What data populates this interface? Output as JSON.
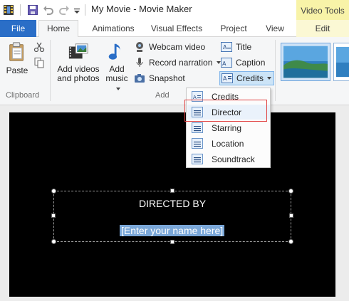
{
  "window": {
    "title": "My Movie - Movie Maker",
    "context_tab_header": "Video Tools"
  },
  "quick_access": {
    "icons": [
      "app-icon",
      "save-icon",
      "undo-icon",
      "redo-icon",
      "customize-arrow-icon"
    ]
  },
  "tabs": [
    {
      "label": "File",
      "active": false
    },
    {
      "label": "Home",
      "active": true
    },
    {
      "label": "Animations",
      "active": false
    },
    {
      "label": "Visual Effects",
      "active": false
    },
    {
      "label": "Project",
      "active": false
    },
    {
      "label": "View",
      "active": false
    },
    {
      "label": "Edit",
      "active": false,
      "context": true
    }
  ],
  "ribbon": {
    "clipboard": {
      "label": "Clipboard",
      "paste": "Paste"
    },
    "add": {
      "label": "Add",
      "add_videos_line1": "Add videos",
      "add_videos_line2": "and photos",
      "add_music_line1": "Add",
      "add_music_line2": "music",
      "webcam": "Webcam video",
      "narration": "Record narration",
      "snapshot": "Snapshot",
      "title": "Title",
      "caption": "Caption",
      "credits": "Credits"
    }
  },
  "credits_menu": {
    "items": [
      {
        "label": "Credits",
        "highlighted": false
      },
      {
        "label": "Director",
        "highlighted": true
      },
      {
        "label": "Starring",
        "highlighted": false
      },
      {
        "label": "Location",
        "highlighted": false
      },
      {
        "label": "Soundtrack",
        "highlighted": false
      }
    ]
  },
  "preview": {
    "heading": "DIRECTED BY",
    "placeholder": "[Enter your name here]"
  },
  "colors": {
    "file_tab": "#2a6ec7",
    "context_header": "#f8f3a8",
    "selection": "#7aa7d8",
    "highlight_outline": "#e04040"
  }
}
